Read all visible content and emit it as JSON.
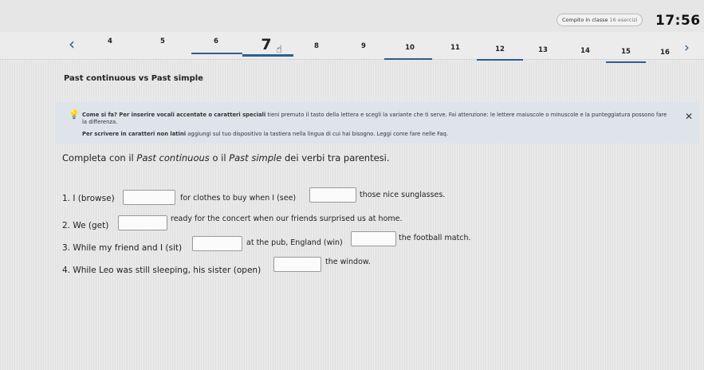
{
  "header": {
    "assignment_title": "Compito in classe",
    "assignment_sub": "16 esercizi",
    "timer": "17:56"
  },
  "pager": {
    "prev_icon": "chevron-left-icon",
    "next_icon": "chevron-right-icon",
    "pages": [
      "4",
      "5",
      "6",
      "7",
      "8",
      "9",
      "10",
      "11",
      "12",
      "13",
      "14",
      "15",
      "16"
    ],
    "current": "7",
    "cursor_icon": "hand-pointer-icon"
  },
  "section": {
    "title": "Past continuous vs Past simple"
  },
  "help": {
    "icon": "lightbulb-icon",
    "lead": "Come si fa? Per inserire vocali accentate o caratteri speciali",
    "text1": " tieni premuto il tasto della lettera e scegli la variante che ti serve. Fai attenzione: le lettere maiuscole o minuscole e la punteggiatura possono fare la differenza.",
    "lead2": "Per scrivere in caratteri non latini",
    "text2": " aggiungi sul tuo dispositivo la tastiera nella lingua di cui hai bisogno. Leggi come fare nelle Faq.",
    "close_icon": "close-icon"
  },
  "instructions": {
    "before": "Completa con il ",
    "em1": "Past continuous",
    "mid": " o il ",
    "em2": "Past simple",
    "after": " dei verbi tra parentesi."
  },
  "exercise": [
    {
      "prompt": "1. I (browse)",
      "f1": "for clothes to buy when I (see)",
      "f2": "those nice sunglasses."
    },
    {
      "prompt": "2. We (get)",
      "f1": "ready for the concert when our friends surprised us at home."
    },
    {
      "prompt": "3. While my friend and I (sit)",
      "f1": "at the pub, England (win)",
      "f2": "the football match."
    },
    {
      "prompt": "4. While Leo was still sleeping, his sister (open)",
      "f1": "the window."
    }
  ]
}
